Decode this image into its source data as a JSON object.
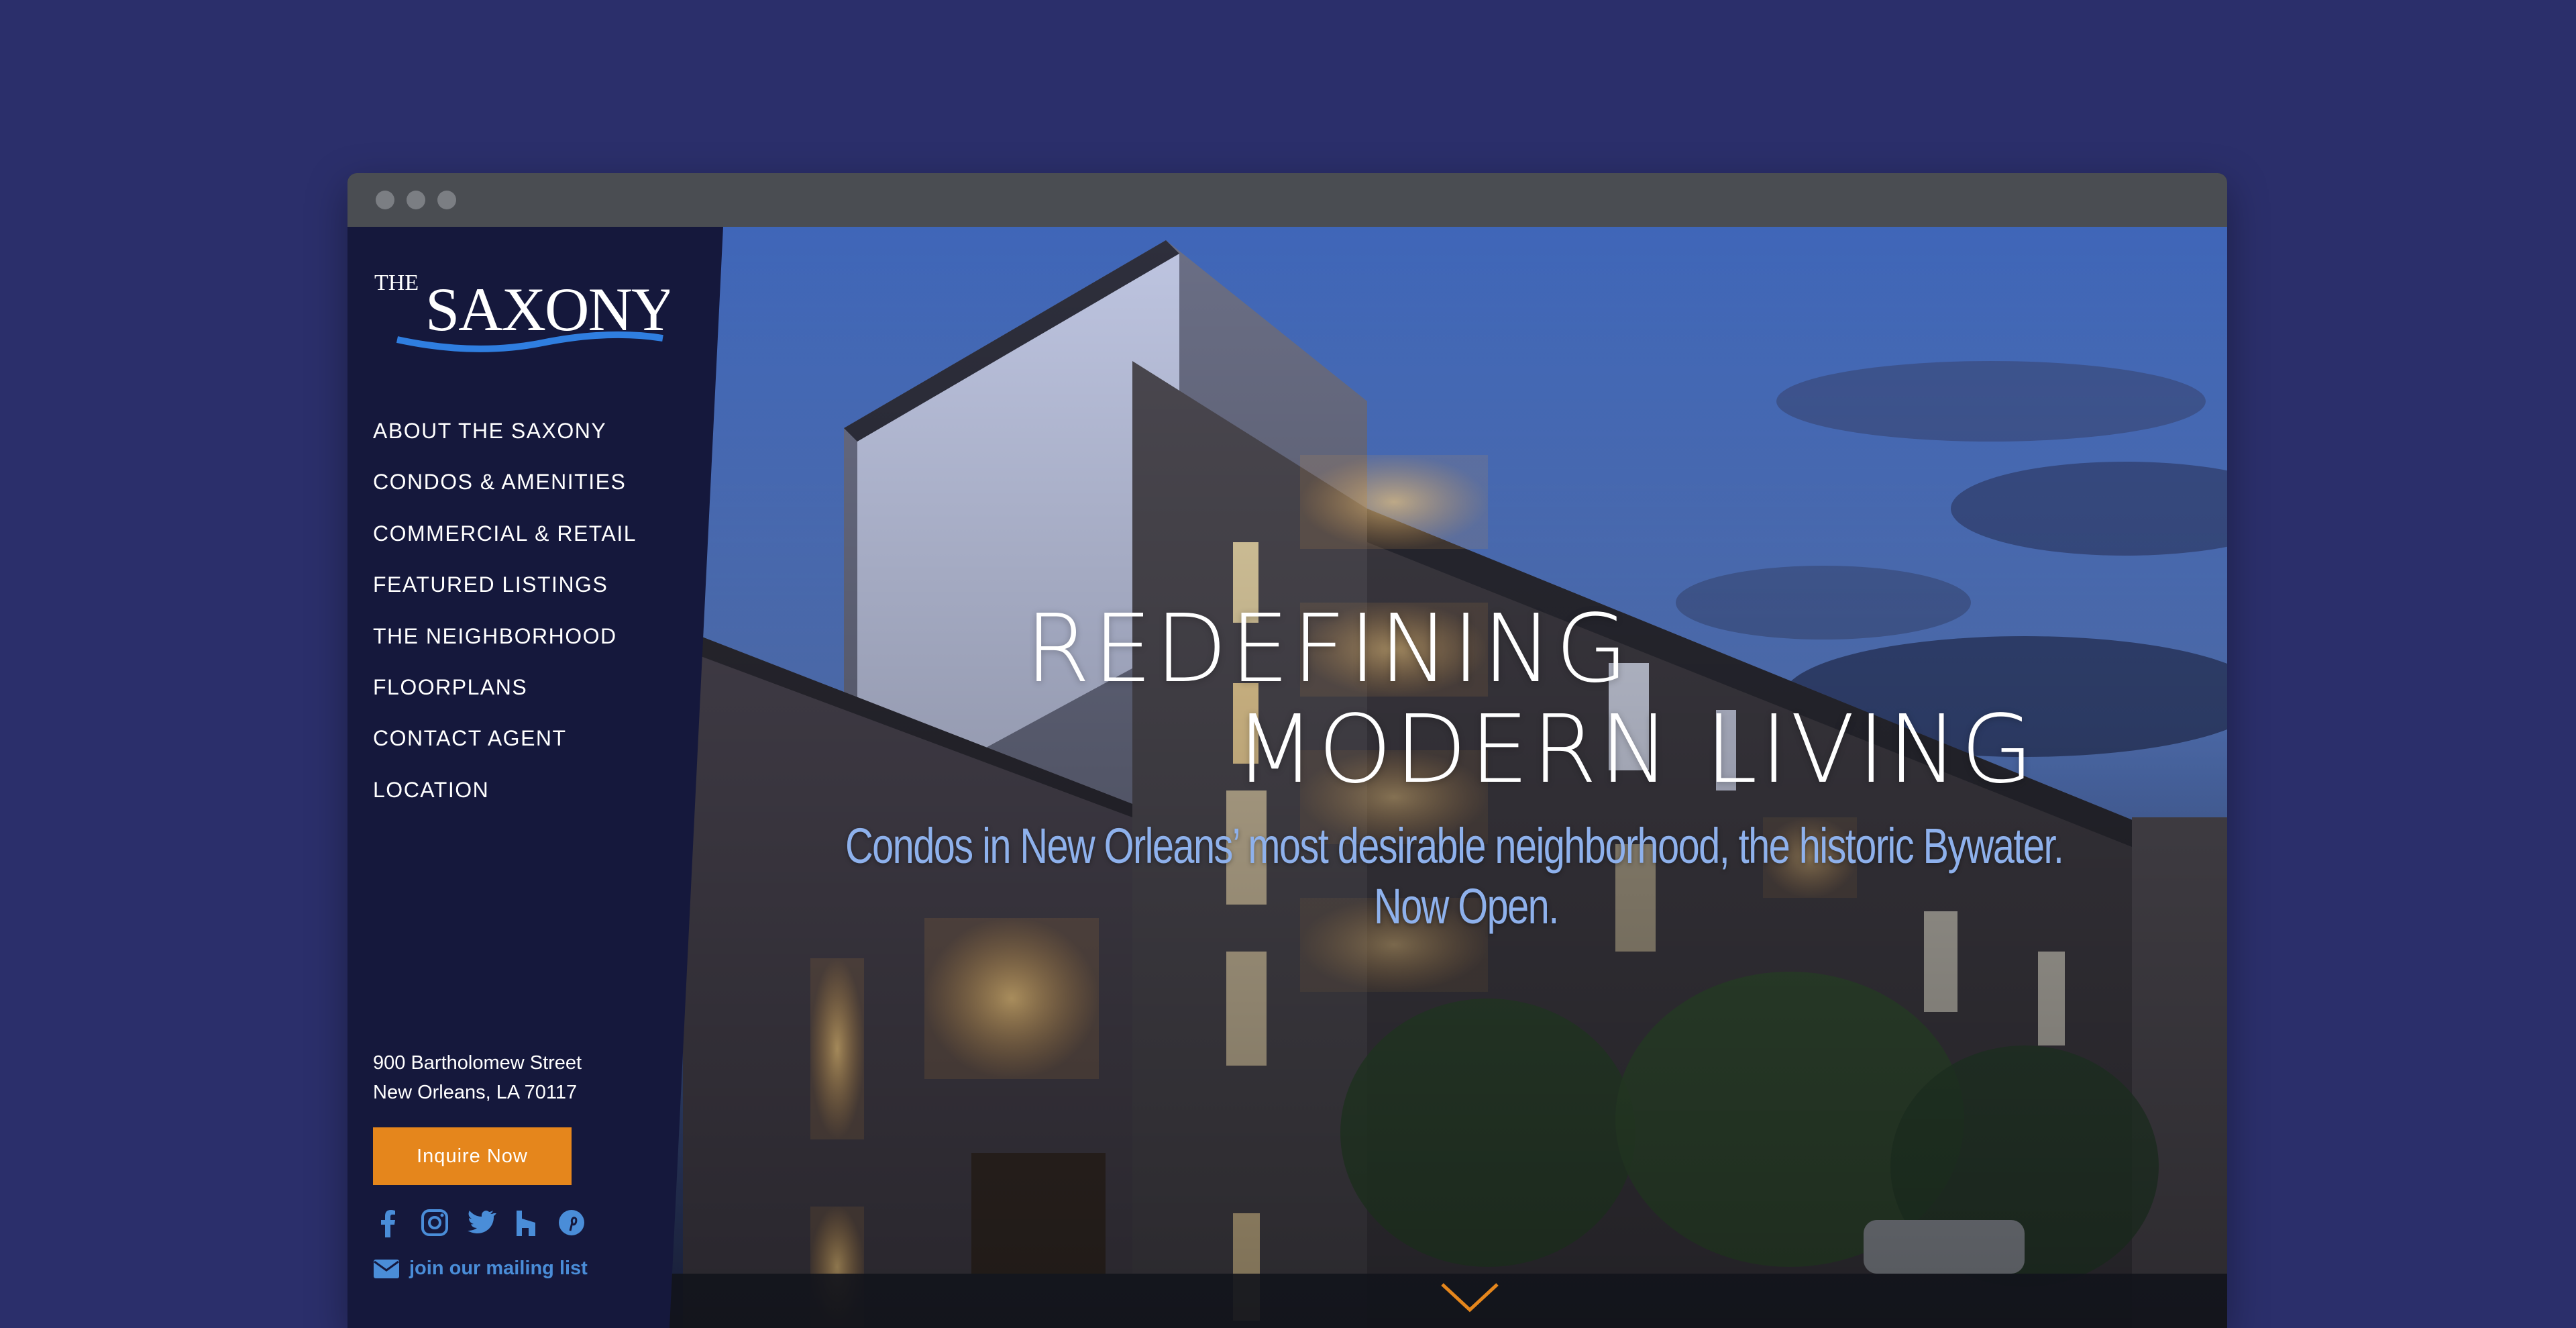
{
  "brand": {
    "logo_small": "THE",
    "logo_main": "SAXONY"
  },
  "nav": [
    "ABOUT THE SAXONY",
    "CONDOS & AMENITIES",
    "COMMERCIAL & RETAIL",
    "FEATURED LISTINGS",
    "THE NEIGHBORHOOD",
    "FLOORPLANS",
    "CONTACT AGENT",
    "LOCATION"
  ],
  "address": {
    "line1": "900 Bartholomew Street",
    "line2": "New Orleans, LA 70117"
  },
  "cta": {
    "inquire": "Inquire Now"
  },
  "social_icons": [
    "facebook-icon",
    "instagram-icon",
    "twitter-icon",
    "houzz-icon",
    "pinterest-icon"
  ],
  "mailing": {
    "label": "join our mailing list",
    "icon": "envelope-icon"
  },
  "hero": {
    "headline_line1": "REDEFINING",
    "headline_line2": "MODERN LIVING",
    "sub_line1": "Condos in New Orleans’ most desirable neighborhood, the historic Bywater.",
    "sub_line2": "Now Open.",
    "scroll_icon": "chevron-down-icon"
  },
  "colors": {
    "page_bg": "#2b2f6b",
    "sidebar_bg": "#15183c",
    "accent_orange": "#e5861c",
    "link_blue": "#4a8dd8",
    "subhead_blue": "#8eb1ec"
  }
}
